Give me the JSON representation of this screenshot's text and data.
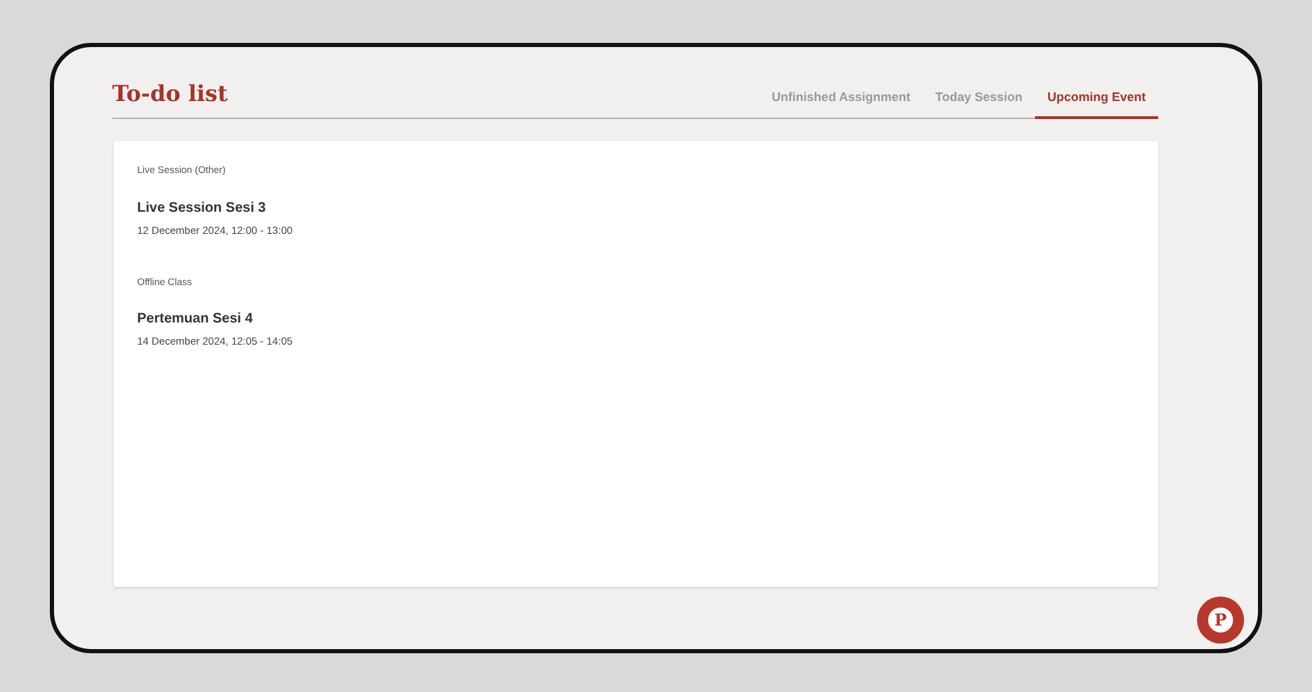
{
  "header": {
    "title": "To-do list"
  },
  "tabs": [
    {
      "label": "Unfinished Assignment",
      "selected": false
    },
    {
      "label": "Today Session",
      "selected": false
    },
    {
      "label": "Upcoming Event",
      "selected": true
    }
  ],
  "events": [
    {
      "category": "Live Session (Other)",
      "title": "Live Session Sesi 3",
      "time": "12 December 2024, 12:00 - 13:00"
    },
    {
      "category": "Offline Class",
      "title": "Pertemuan Sesi 4",
      "time": "14 December 2024, 12:05 - 14:05"
    }
  ],
  "chat_button": {
    "letter": "P"
  }
}
